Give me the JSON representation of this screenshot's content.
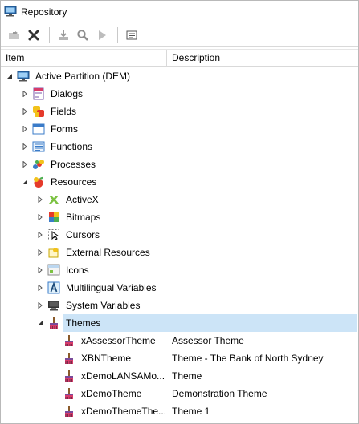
{
  "window": {
    "title": "Repository"
  },
  "toolbar": {
    "buttons": [
      {
        "name": "open-icon"
      },
      {
        "name": "delete-icon"
      },
      {
        "name": "import-icon"
      },
      {
        "name": "find-icon"
      },
      {
        "name": "run-icon"
      },
      {
        "name": "properties-icon"
      }
    ]
  },
  "columns": {
    "item": "Item",
    "description": "Description"
  },
  "tree": {
    "root": {
      "label": "Active Partition (DEM)"
    },
    "nodes": [
      {
        "label": "Dialogs"
      },
      {
        "label": "Fields"
      },
      {
        "label": "Forms"
      },
      {
        "label": "Functions"
      },
      {
        "label": "Processes"
      },
      {
        "label": "Resources"
      },
      {
        "label": "ActiveX"
      },
      {
        "label": "Bitmaps"
      },
      {
        "label": "Cursors"
      },
      {
        "label": "External Resources"
      },
      {
        "label": "Icons"
      },
      {
        "label": "Multilingual Variables"
      },
      {
        "label": "System Variables"
      },
      {
        "label": "Themes"
      }
    ],
    "themes": [
      {
        "label": "xAssessorTheme",
        "description": "Assessor Theme"
      },
      {
        "label": "XBNTheme",
        "description": "Theme - The Bank of North Sydney"
      },
      {
        "label": "xDemoLANSAMo...",
        "description": "Theme"
      },
      {
        "label": "xDemoTheme",
        "description": "Demonstration Theme"
      },
      {
        "label": "xDemoThemeThe...",
        "description": "Theme 1"
      }
    ]
  },
  "colors": {
    "selection": "#cce4f7"
  }
}
